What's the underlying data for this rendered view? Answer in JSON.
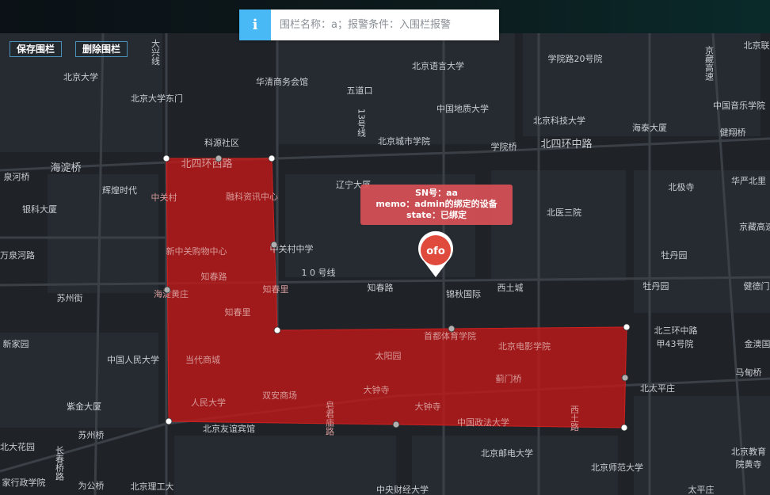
{
  "toolbar": {
    "save_label": "保存围栏",
    "delete_label": "删除围栏"
  },
  "info_panel": {
    "icon": "i",
    "text": "围栏名称：a；报警条件：入围栏报警"
  },
  "marker": {
    "logo": "ofo",
    "sn_line": "SN号：aa",
    "memo_line": "memo：admin的绑定的设备",
    "state_line": "state：已绑定"
  },
  "colors": {
    "fence_fill": "#c01818",
    "map_bg": "#1f2328",
    "info_accent": "#48b9f5",
    "marker_red": "#e04a3c"
  },
  "map": {
    "labels": [
      "北京大学",
      "北京大学东门",
      "华清商务会馆",
      "五道口",
      "北京语言大学",
      "学院路20号院",
      "北京联",
      "中国地质大学",
      "北京科技大学",
      "中国音乐学院",
      "海泰大厦",
      "健翔桥",
      "科源社区",
      "北京城市学院",
      "学院桥",
      "北四环中路",
      "海淀桥",
      "北四环西路",
      "辽宁大厦",
      "北极寺",
      "华严北里",
      "辉煌时代",
      "中关村",
      "融科资讯中心",
      "北医三院",
      "银科大厦",
      "新中关购物中心",
      "中关村中学",
      "牡丹园",
      "知春路",
      "1 0 号线",
      "知春路",
      "锦秋国际",
      "西土城",
      "牡丹园",
      "海淀黄庄",
      "知春里",
      "苏州街",
      "知春里",
      "首都体育学院",
      "北三环中路",
      "甲43号院",
      "新家园",
      "中国人民大学",
      "当代商城",
      "太阳园",
      "北京电影学院",
      "蓟门桥",
      "马甸桥",
      "双安商场",
      "大钟寺",
      "北太平庄",
      "人民大学",
      "紫金大厦",
      "大钟寺",
      "中国政法大学",
      "北京友谊宾馆",
      "苏州桥",
      "北京邮电大学",
      "北京师范大学",
      "为公桥",
      "北京理工大",
      "北京教育",
      "院黄寺",
      "家行政学院",
      "北大花园",
      "泉河桥",
      "金澳国",
      "健德门",
      "京藏高速",
      "万泉河路",
      "大兴线",
      "13号线",
      "皂君庙路",
      "西土路",
      "京藏高速",
      "长春桥路",
      "中央财经大学",
      "太平庄"
    ]
  }
}
